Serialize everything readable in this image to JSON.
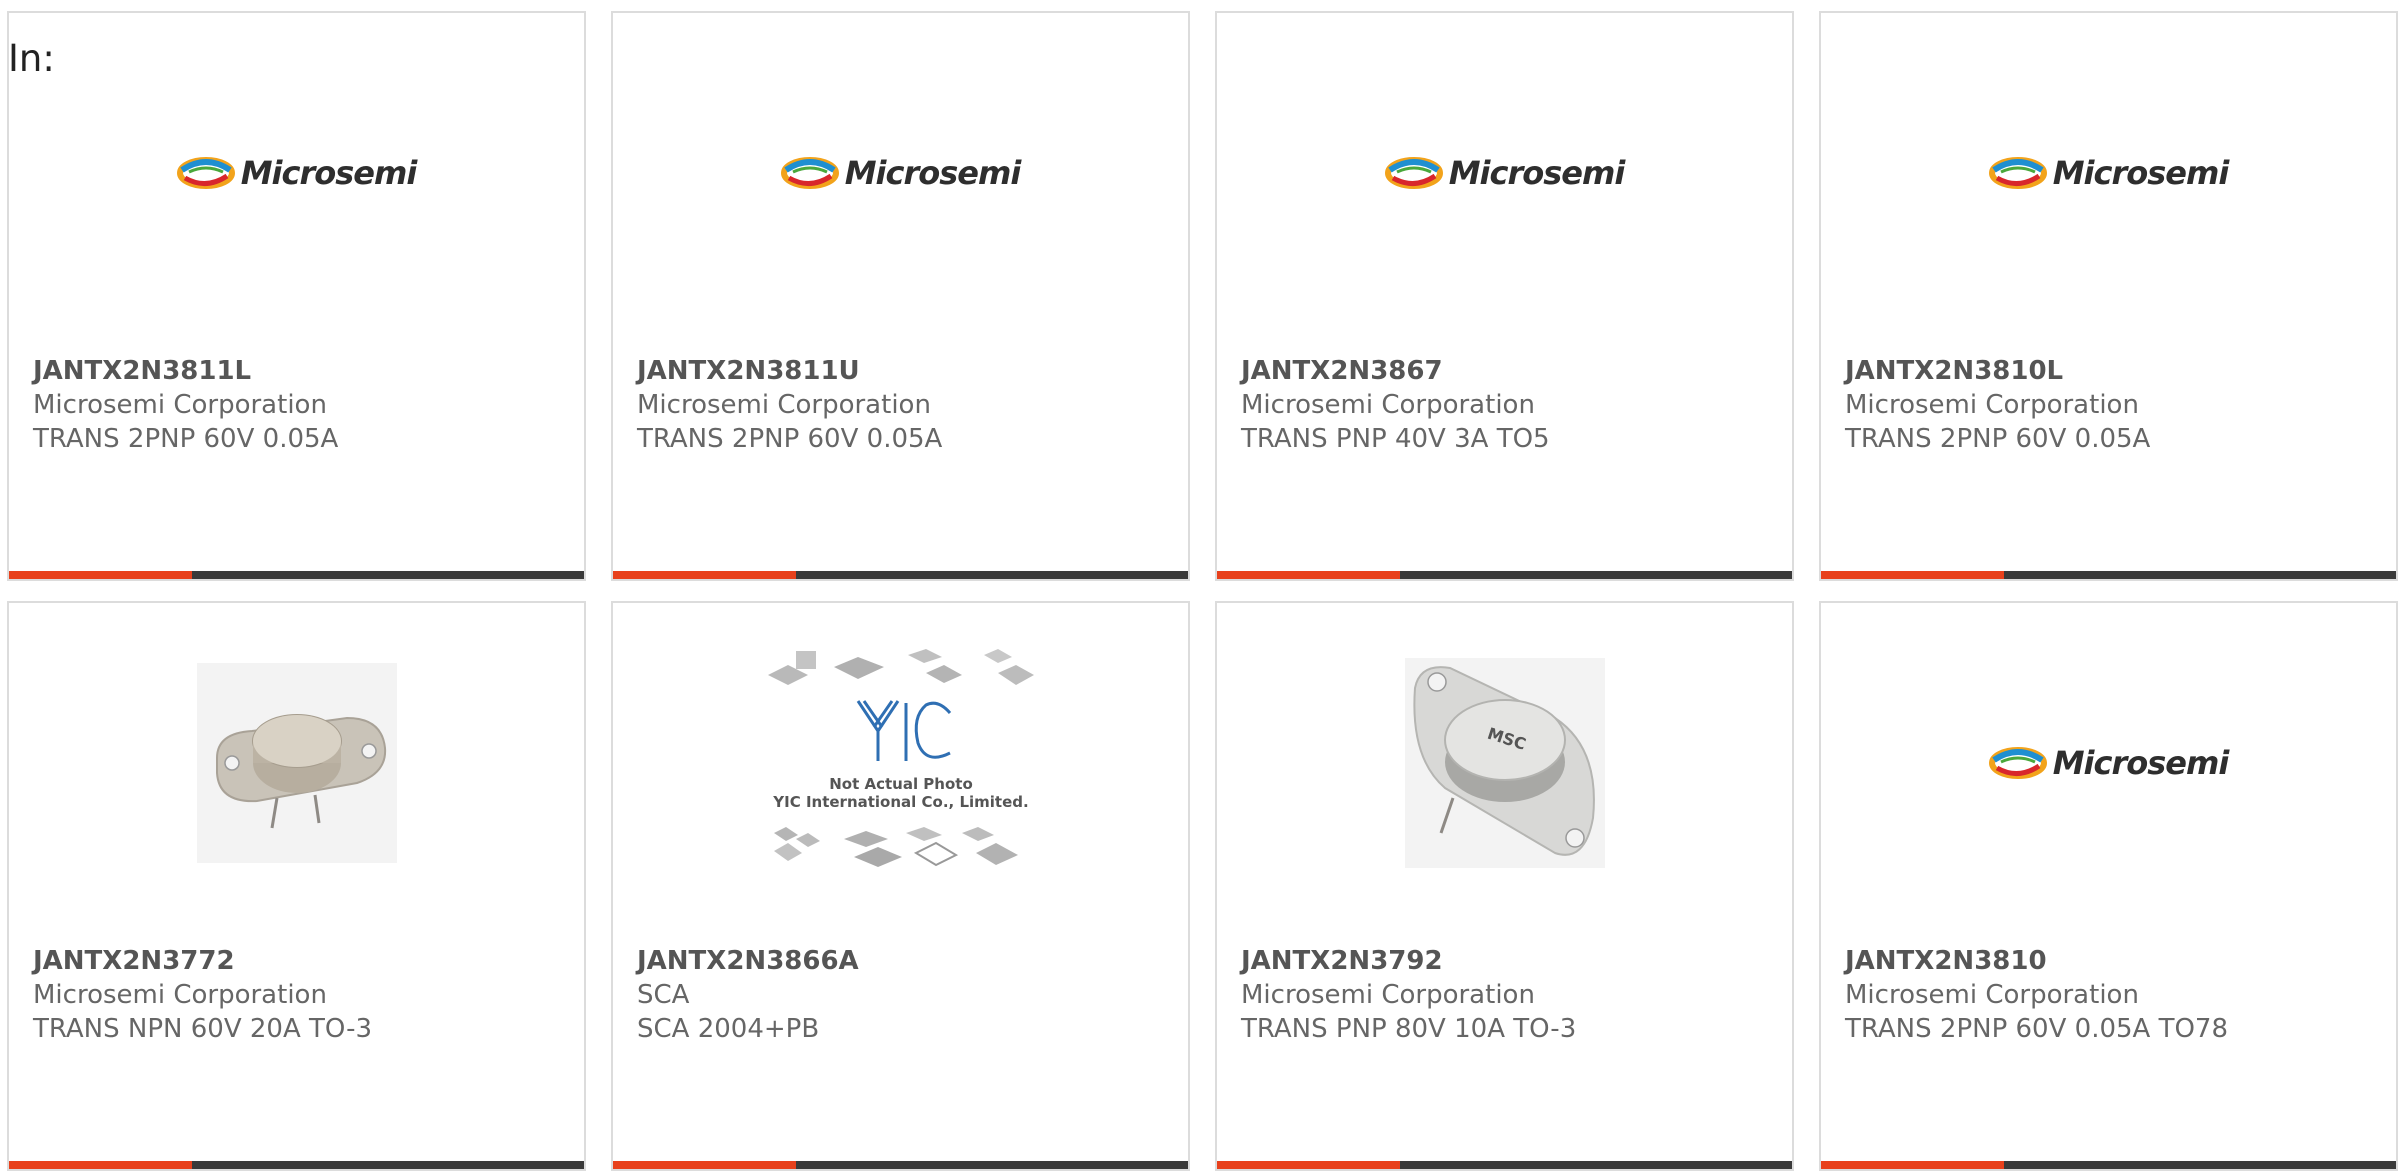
{
  "prefix_label": "In:",
  "colors": {
    "accent": "#e8411c",
    "bar_dark": "#3a3a3a",
    "card_border": "#dcdcdc"
  },
  "products": [
    {
      "part": "JANTX2N3811L",
      "manufacturer": "Microsemi Corporation",
      "description": "TRANS 2PNP 60V 0.05A",
      "image": "microsemi-logo",
      "logo_text": "Microsemi"
    },
    {
      "part": "JANTX2N3811U",
      "manufacturer": "Microsemi Corporation",
      "description": "TRANS 2PNP 60V 0.05A",
      "image": "microsemi-logo",
      "logo_text": "Microsemi"
    },
    {
      "part": "JANTX2N3867",
      "manufacturer": "Microsemi Corporation",
      "description": "TRANS PNP 40V 3A TO5",
      "image": "microsemi-logo",
      "logo_text": "Microsemi"
    },
    {
      "part": "JANTX2N3810L",
      "manufacturer": "Microsemi Corporation",
      "description": "TRANS 2PNP 60V 0.05A",
      "image": "microsemi-logo",
      "logo_text": "Microsemi"
    },
    {
      "part": "JANTX2N3772",
      "manufacturer": "Microsemi Corporation",
      "description": "TRANS NPN 60V 20A TO-3",
      "image": "to3-transistor-photo"
    },
    {
      "part": "JANTX2N3866A",
      "manufacturer": "SCA",
      "description": "SCA 2004+PB",
      "image": "not-actual-photo-placeholder",
      "placeholder_line1": "Not Actual Photo",
      "placeholder_line2": "YIC International Co., Limited."
    },
    {
      "part": "JANTX2N3792",
      "manufacturer": "Microsemi Corporation",
      "description": "TRANS PNP 80V 10A TO-3",
      "image": "to3-transistor-photo-msc",
      "chip_marking": "MSC"
    },
    {
      "part": "JANTX2N3810",
      "manufacturer": "Microsemi Corporation",
      "description": "TRANS 2PNP 60V 0.05A TO78",
      "image": "microsemi-logo",
      "logo_text": "Microsemi"
    }
  ]
}
